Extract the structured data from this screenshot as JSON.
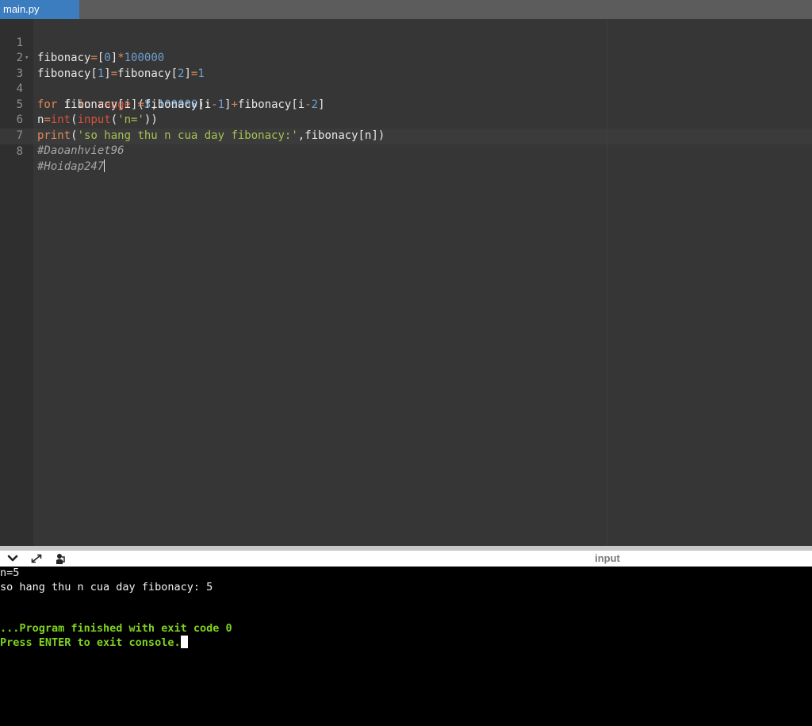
{
  "tab": {
    "filename": "main.py"
  },
  "editor": {
    "line_numbers": [
      "1",
      "2",
      "3",
      "4",
      "5",
      "6",
      "7",
      "8"
    ],
    "lines": [
      "fibonacy=[0]*100000",
      "fibonacy[1]=fibonacy[2]=1",
      "for i in range (3,100000):",
      "    fibonacy[i]=fibonacy[i-1]+fibonacy[i-2]",
      "n=int(input('n='))",
      "print('so hang thu n cua day fibonacy:',fibonacy[n])",
      "#Daoanhviet96",
      "#Hoidap247"
    ],
    "fold_marker": "▾"
  },
  "console_toolbar": {
    "label": "input",
    "icons": [
      "chevron-down-icon",
      "expand-icon",
      "settings-icon"
    ]
  },
  "console": {
    "output": [
      "n=5",
      "so hang thu n cua day fibonacy: 5"
    ],
    "finished": "...Program finished with exit code 0",
    "press_enter": "Press ENTER to exit console."
  }
}
